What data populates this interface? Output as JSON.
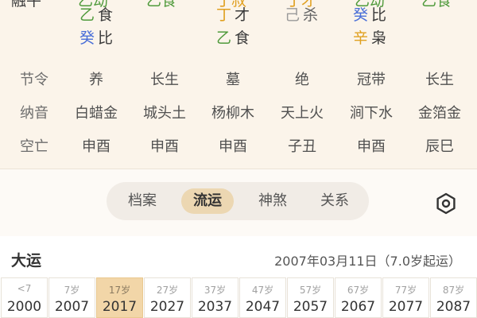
{
  "top_partial": {
    "col0_cut": "融牛",
    "col1": [
      {
        "gan": "乙",
        "gan_color": "#4f9a3b",
        "shen": "食"
      },
      {
        "gan": "癸",
        "gan_color": "#4a6fd8",
        "shen": "比"
      }
    ],
    "col1_cut": "乙劫",
    "col2_cut": "乙食",
    "col3": [
      {
        "gan": "丁",
        "gan_color": "#e0a020",
        "shen": "才"
      },
      {
        "gan": "乙",
        "gan_color": "#4f9a3b",
        "shen": "食"
      }
    ],
    "col3_cut": "丁叔",
    "col4": [
      {
        "gan": "己",
        "gan_color": "#9a9a9a",
        "shen": "杀"
      }
    ],
    "col4_cut": "丁才",
    "col5": [
      {
        "gan": "癸",
        "gan_color": "#4a6fd8",
        "shen": "比"
      },
      {
        "gan": "辛",
        "gan_color": "#e0a020",
        "shen": "枭"
      }
    ],
    "col5_cut": "乙劫",
    "col6_cut": "乙食"
  },
  "info_table": {
    "rows": [
      [
        "节令",
        "养",
        "长生",
        "墓",
        "绝",
        "冠带",
        "长生"
      ],
      [
        "纳音",
        "白蜡金",
        "城头土",
        "杨柳木",
        "天上火",
        "涧下水",
        "金箔金"
      ],
      [
        "空亡",
        "申酉",
        "申酉",
        "申酉",
        "子丑",
        "申酉",
        "辰巳"
      ]
    ]
  },
  "tabs": [
    {
      "label": "档案",
      "active": false
    },
    {
      "label": "流运",
      "active": true
    },
    {
      "label": "神煞",
      "active": false
    },
    {
      "label": "关系",
      "active": false
    }
  ],
  "icons": {
    "settings": "hexagon-settings-icon"
  },
  "dayun": {
    "title": "大运",
    "start_date": "2007年03月11日（7.0岁起运）",
    "items": [
      {
        "age": "<7",
        "year": "2000",
        "active": false
      },
      {
        "age": "7岁",
        "year": "2007",
        "active": false
      },
      {
        "age": "17岁",
        "year": "2017",
        "active": true
      },
      {
        "age": "27岁",
        "year": "2027",
        "active": false
      },
      {
        "age": "37岁",
        "year": "2037",
        "active": false
      },
      {
        "age": "47岁",
        "year": "2047",
        "active": false
      },
      {
        "age": "57岁",
        "year": "2057",
        "active": false
      },
      {
        "age": "67岁",
        "year": "2067",
        "active": false
      },
      {
        "age": "77岁",
        "year": "2077",
        "active": false
      },
      {
        "age": "87岁",
        "year": "2087",
        "active": false
      }
    ]
  },
  "colors": {
    "accent": "#ecd7b2",
    "active_cell": "#f2d6a8",
    "background": "#fbf4ea"
  }
}
